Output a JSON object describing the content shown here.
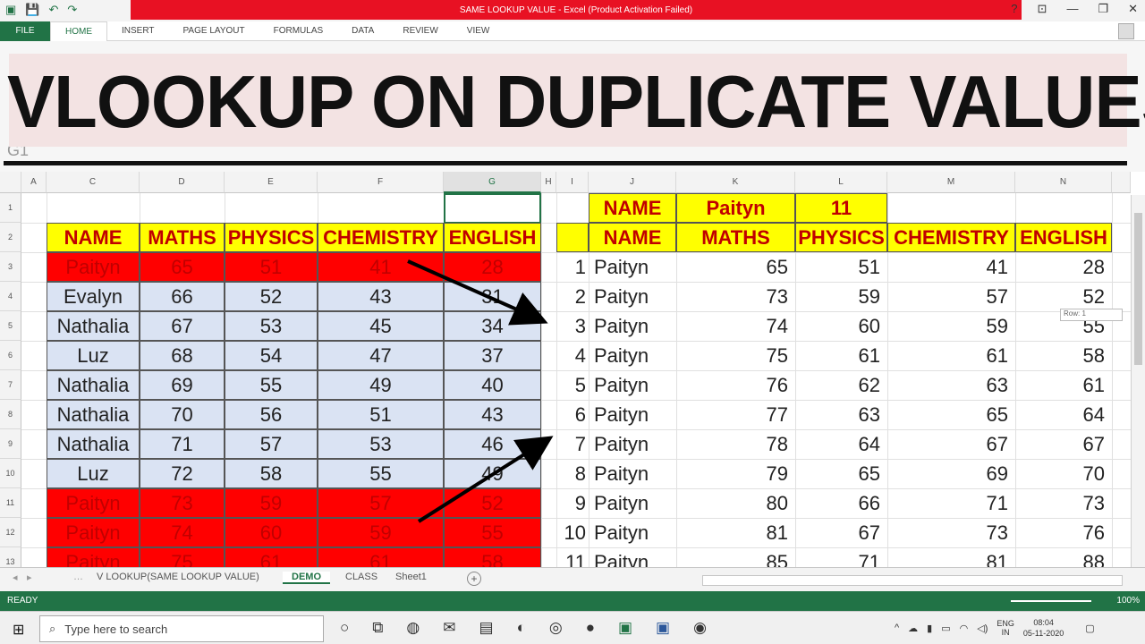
{
  "window": {
    "title": "SAME LOOKUP VALUE - Excel (Product Activation Failed)",
    "controls": [
      "?",
      "⊡",
      "—",
      "❐",
      "✕"
    ]
  },
  "ribbon": {
    "file": "FILE",
    "tabs": [
      "HOME",
      "INSERT",
      "PAGE LAYOUT",
      "FORMULAS",
      "DATA",
      "REVIEW",
      "VIEW"
    ]
  },
  "banner": {
    "text": "VLOOKUP ON DUPLICATE VALUES"
  },
  "namebox": {
    "value": "G1"
  },
  "columns": {
    "left": [
      "A",
      "C",
      "D",
      "E",
      "F",
      "G",
      "H"
    ],
    "right": [
      "I",
      "J",
      "K",
      "L",
      "M",
      "N"
    ]
  },
  "rows": [
    "1",
    "2",
    "3",
    "4",
    "5",
    "6",
    "7",
    "8",
    "9",
    "10",
    "11",
    "12",
    "13"
  ],
  "left_table": {
    "headers": [
      "NAME",
      "MATHS",
      "PHYSICS",
      "CHEMISTRY",
      "ENGLISH"
    ],
    "rows": [
      {
        "name": "Paityn",
        "vals": [
          "65",
          "51",
          "41",
          "28"
        ],
        "style": "red"
      },
      {
        "name": "Evalyn",
        "vals": [
          "66",
          "52",
          "43",
          "31"
        ],
        "style": "blu"
      },
      {
        "name": "Nathalia",
        "vals": [
          "67",
          "53",
          "45",
          "34"
        ],
        "style": "blu"
      },
      {
        "name": "Luz",
        "vals": [
          "68",
          "54",
          "47",
          "37"
        ],
        "style": "blu"
      },
      {
        "name": "Nathalia",
        "vals": [
          "69",
          "55",
          "49",
          "40"
        ],
        "style": "blu"
      },
      {
        "name": "Nathalia",
        "vals": [
          "70",
          "56",
          "51",
          "43"
        ],
        "style": "blu"
      },
      {
        "name": "Nathalia",
        "vals": [
          "71",
          "57",
          "53",
          "46"
        ],
        "style": "blu"
      },
      {
        "name": "Luz",
        "vals": [
          "72",
          "58",
          "55",
          "49"
        ],
        "style": "blu"
      },
      {
        "name": "Paityn",
        "vals": [
          "73",
          "59",
          "57",
          "52"
        ],
        "style": "red"
      },
      {
        "name": "Paityn",
        "vals": [
          "74",
          "60",
          "59",
          "55"
        ],
        "style": "red"
      },
      {
        "name": "Paityn",
        "vals": [
          "75",
          "61",
          "61",
          "58"
        ],
        "style": "red"
      }
    ]
  },
  "lookup_row": [
    "NAME",
    "Paityn",
    "11"
  ],
  "right_table": {
    "headers": [
      "NAME",
      "MATHS",
      "PHYSICS",
      "CHEMISTRY",
      "ENGLISH"
    ],
    "rows": [
      {
        "n": "1",
        "name": "Paityn",
        "vals": [
          "65",
          "51",
          "41",
          "28"
        ]
      },
      {
        "n": "2",
        "name": "Paityn",
        "vals": [
          "73",
          "59",
          "57",
          "52"
        ]
      },
      {
        "n": "3",
        "name": "Paityn",
        "vals": [
          "74",
          "60",
          "59",
          "55"
        ]
      },
      {
        "n": "4",
        "name": "Paityn",
        "vals": [
          "75",
          "61",
          "61",
          "58"
        ]
      },
      {
        "n": "5",
        "name": "Paityn",
        "vals": [
          "76",
          "62",
          "63",
          "61"
        ]
      },
      {
        "n": "6",
        "name": "Paityn",
        "vals": [
          "77",
          "63",
          "65",
          "64"
        ]
      },
      {
        "n": "7",
        "name": "Paityn",
        "vals": [
          "78",
          "64",
          "67",
          "67"
        ]
      },
      {
        "n": "8",
        "name": "Paityn",
        "vals": [
          "79",
          "65",
          "69",
          "70"
        ]
      },
      {
        "n": "9",
        "name": "Paityn",
        "vals": [
          "80",
          "66",
          "71",
          "73"
        ]
      },
      {
        "n": "10",
        "name": "Paityn",
        "vals": [
          "81",
          "67",
          "73",
          "76"
        ]
      },
      {
        "n": "11",
        "name": "Paityn",
        "vals": [
          "85",
          "71",
          "81",
          "88"
        ]
      }
    ]
  },
  "tooltip": "Row: 1",
  "sheet_tabs": [
    "V LOOKUP(SAME LOOKUP VALUE)",
    "DEMO",
    "CLASS",
    "Sheet1"
  ],
  "sheet_nav": [
    "◂",
    "▸",
    "…"
  ],
  "status": {
    "ready": "READY",
    "zoom": "100%"
  },
  "taskbar": {
    "search_placeholder": "Type here to search",
    "lang": "ENG",
    "region": "IN",
    "time": "08:04",
    "date": "05-11-2020"
  },
  "colors": {
    "excel_green": "#217346",
    "header_yellow": "#ffff00",
    "header_text": "#c00000",
    "highlight_red": "#ff0000",
    "row_blue": "#dae3f3",
    "title_red": "#e81123"
  }
}
